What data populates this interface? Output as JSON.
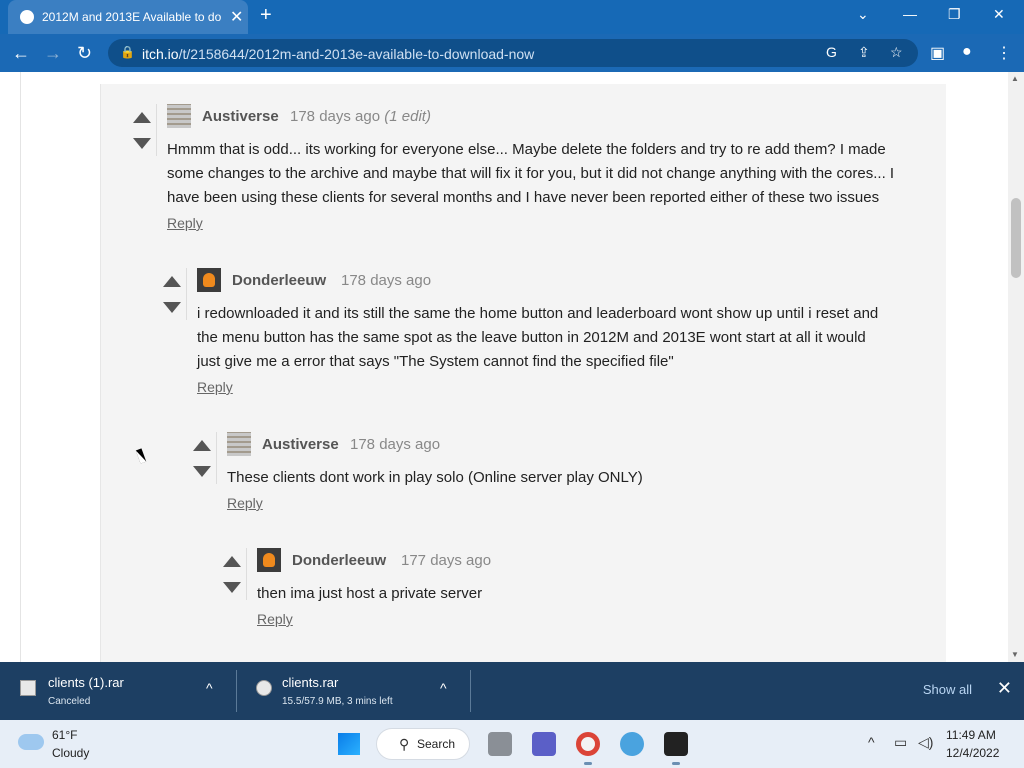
{
  "browser": {
    "tab_title": "2012M and 2013E Available to do",
    "tab_close": "✕",
    "new_tab": "+",
    "url_domain": "itch.io",
    "url_path": "/t/2158644/2012m-and-2013e-available-to-download-now"
  },
  "comments": [
    {
      "author": "Austiverse",
      "time": "178 days ago",
      "edit": "(1 edit)",
      "lines": [
        "Hmmm that is odd... its working for everyone else... Maybe delete the folders and try to re add them? I made",
        "some changes to the archive and maybe that will fix it for you, but it did not change anything with the cores... I",
        "have been using these clients for several months and I have never been reported either of these two issues"
      ],
      "reply": "Reply"
    },
    {
      "author": "Donderleeuw",
      "time": "178 days ago",
      "lines": [
        "i redownloaded it and its still the same the home button and leaderboard wont show up until i reset and",
        "the menu button has the same spot as the leave button in 2012M and 2013E wont start at all it would",
        "just give me a error that says \"The System cannot find the specified file\""
      ],
      "reply": "Reply"
    },
    {
      "author": "Austiverse",
      "time": "178 days ago",
      "lines": [
        "These clients dont work in play solo (Online server play ONLY)"
      ],
      "reply": "Reply"
    },
    {
      "author": "Donderleeuw",
      "time": "177 days ago",
      "lines": [
        "then ima just host a private server"
      ],
      "reply": "Reply"
    }
  ],
  "downloads": {
    "items": [
      {
        "name": "clients (1).rar",
        "status": "Canceled"
      },
      {
        "name": "clients.rar",
        "status": "15.5/57.9 MB, 3 mins left"
      }
    ],
    "show_all": "Show all"
  },
  "taskbar": {
    "temperature": "61°F",
    "weather": "Cloudy",
    "search_label": "Search",
    "time": "11:49 AM",
    "date": "12/4/2022"
  }
}
